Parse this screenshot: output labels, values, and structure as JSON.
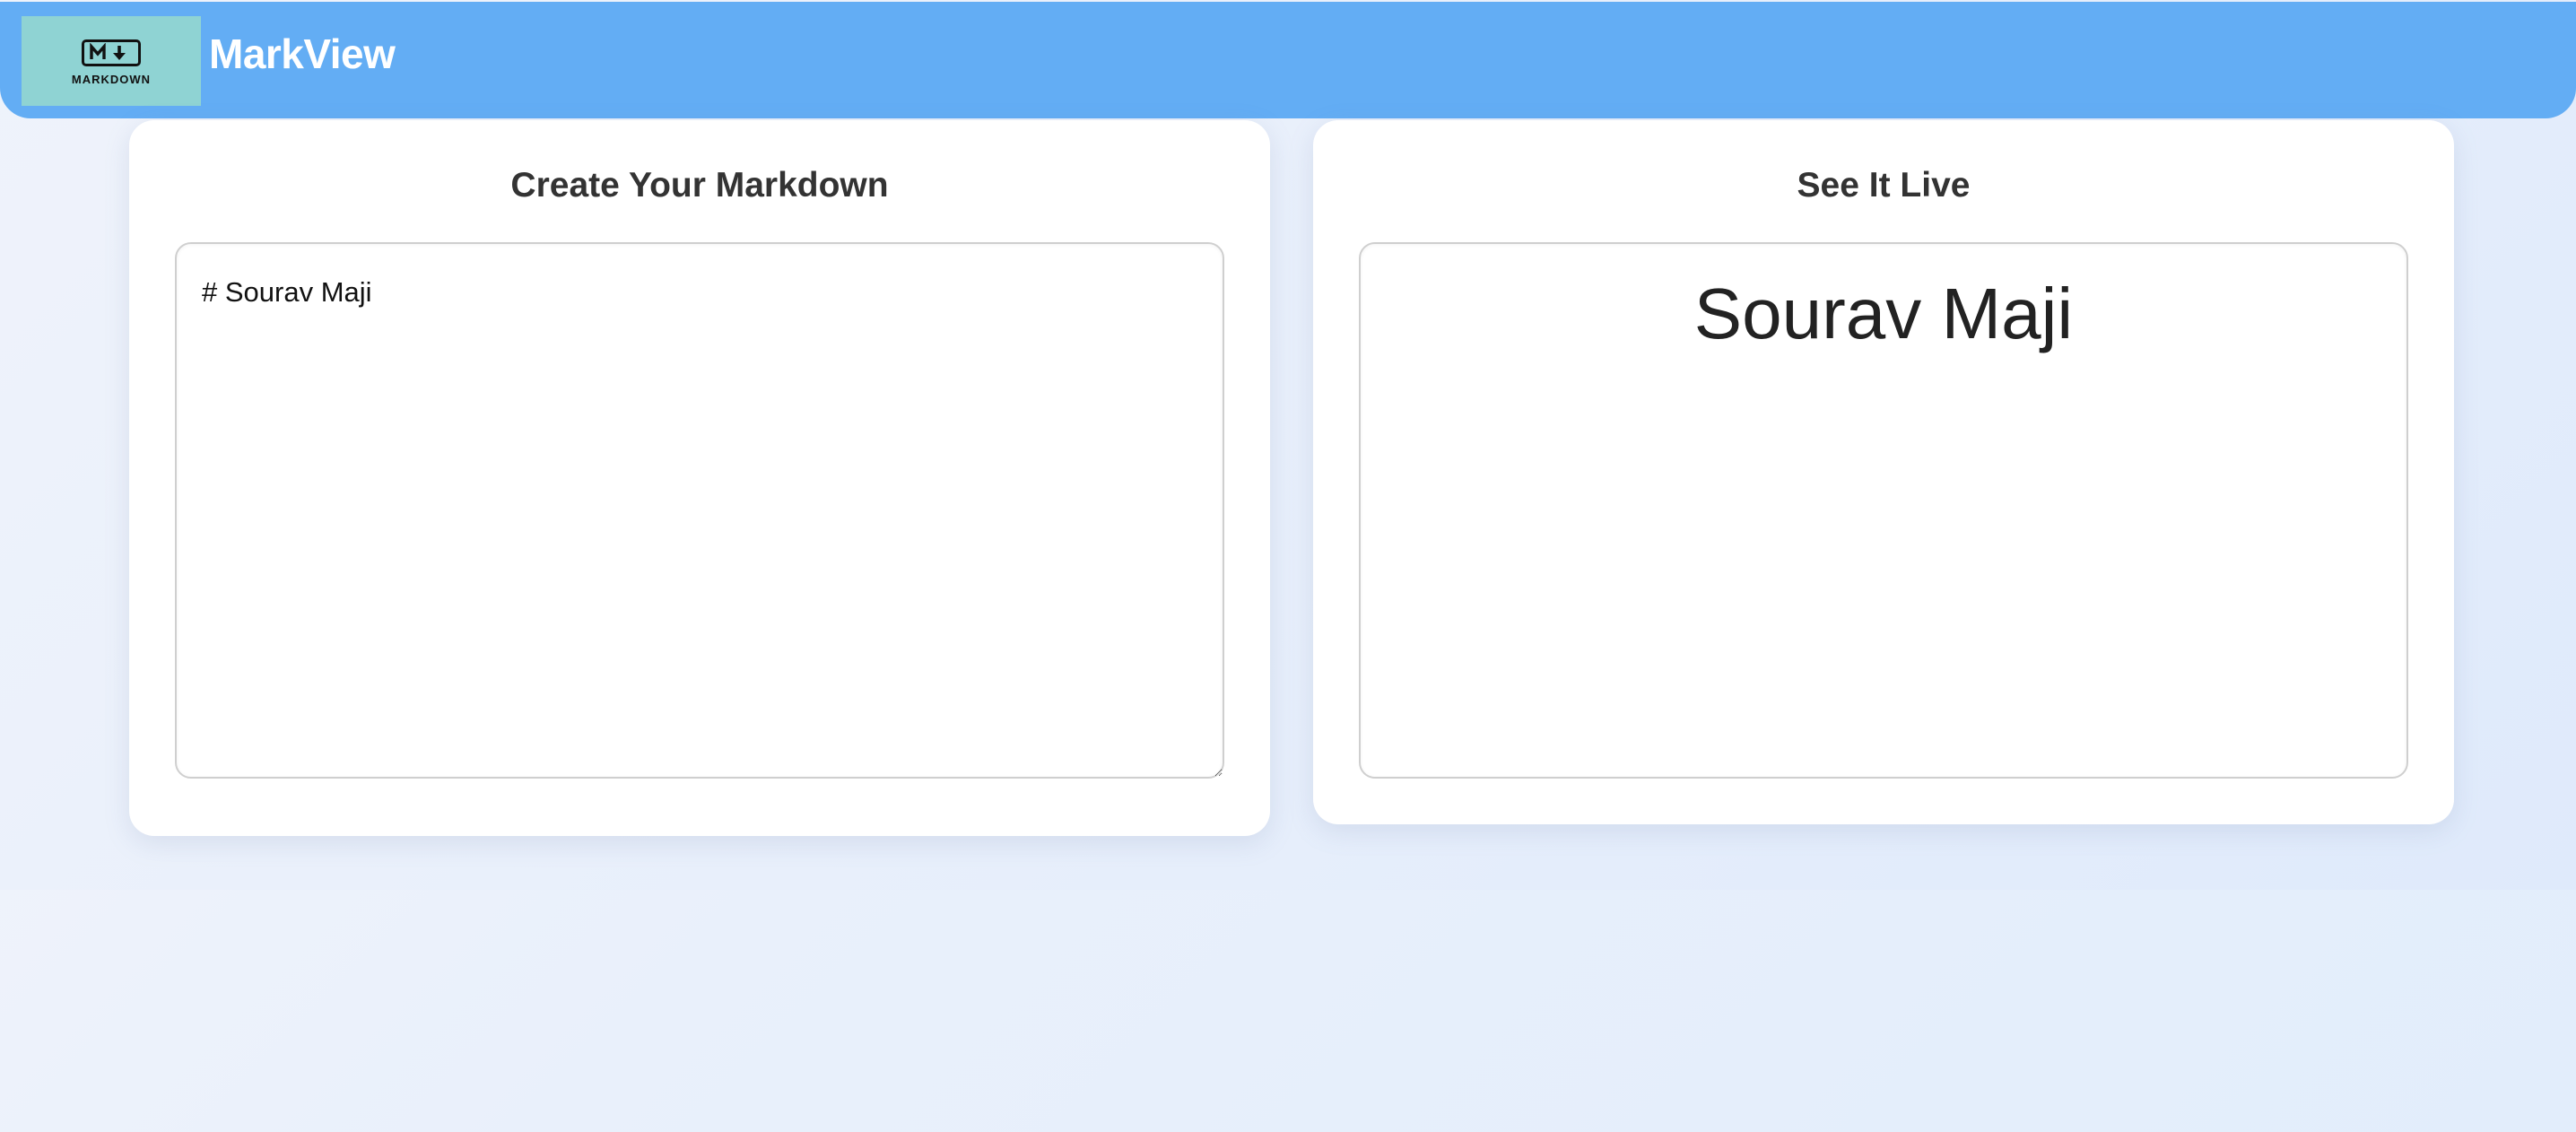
{
  "header": {
    "logo": {
      "icon": "markdown-mark-icon",
      "text": "MARKDOWN",
      "background": "#8fd3d3"
    },
    "brand_title": "MarkView",
    "background": "#63adf4"
  },
  "editor_panel": {
    "title": "Create Your Markdown",
    "textarea_value": "# Sourav Maji"
  },
  "preview_panel": {
    "title": "See It Live",
    "rendered_heading": "Sourav Maji"
  }
}
